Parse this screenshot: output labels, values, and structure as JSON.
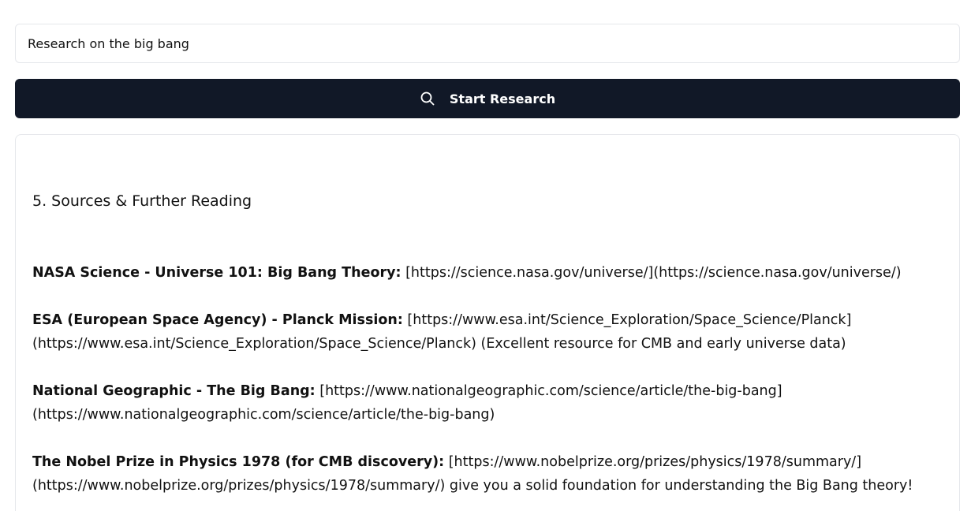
{
  "search": {
    "value": "Research on the big bang"
  },
  "start_button": {
    "label": "Start Research",
    "icon": "search-icon"
  },
  "result": {
    "section_heading": "5. Sources & Further Reading",
    "sources": [
      {
        "name": "NASA Science - Universe 101: Big Bang Theory:",
        "text": "[https://science.nasa.gov/universe/](https://science.nasa.gov/universe/)"
      },
      {
        "name": "ESA (European Space Agency) - Planck Mission:",
        "text": "[https://www.esa.int/Science_Exploration/Space_Science/Planck](https://www.esa.int/Science_Exploration/Space_Science/Planck) (Excellent resource for CMB and early universe data)"
      },
      {
        "name": "National Geographic - The Big Bang:",
        "text": "[https://www.nationalgeographic.com/science/article/the-big-bang](https://www.nationalgeographic.com/science/article/the-big-bang)"
      },
      {
        "name": "The Nobel Prize in Physics 1978 (for CMB discovery):",
        "text": "[https://www.nobelprize.org/prizes/physics/1978/summary/](https://www.nobelprize.org/prizes/physics/1978/summary/) give you a solid foundation for understanding the Big Bang theory!"
      }
    ]
  },
  "colors": {
    "button_bg": "#111827",
    "border": "#e5e7eb",
    "text": "#111111"
  }
}
